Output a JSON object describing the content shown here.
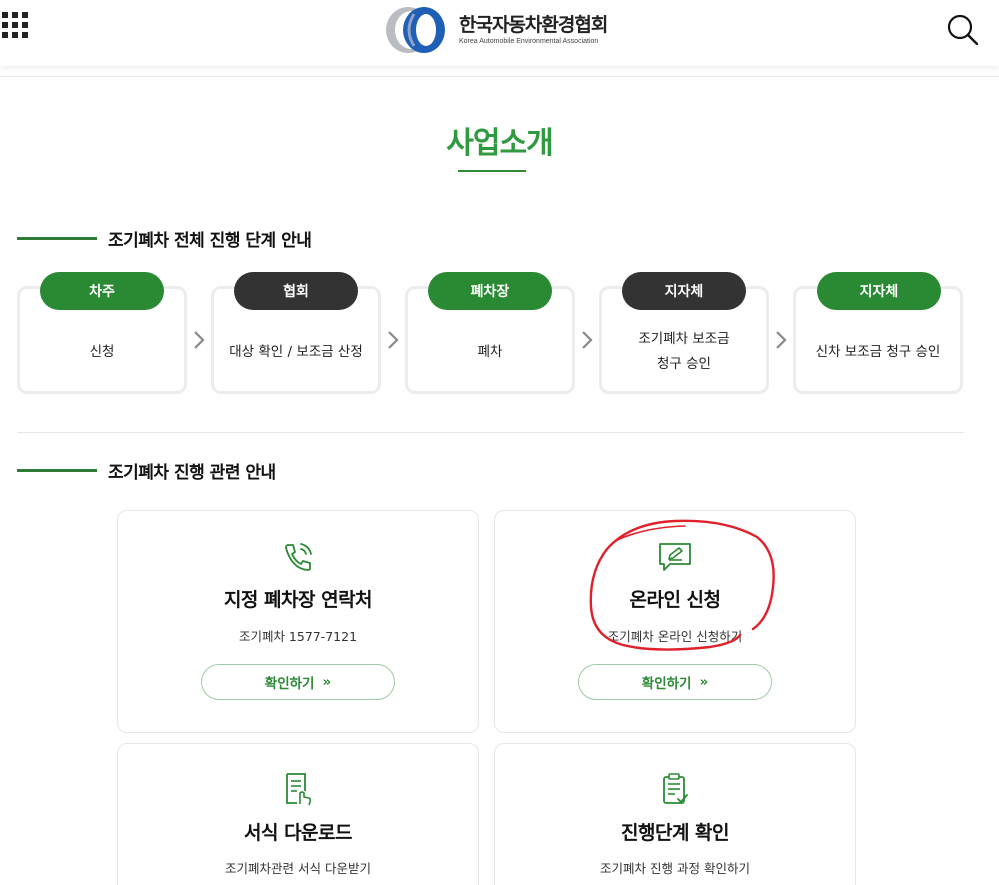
{
  "header": {
    "logo_ko": "한국자동차환경협회",
    "logo_en": "Korea Automobile Environmental Association",
    "menu_icon": "grid-menu-icon",
    "search_icon": "search-icon"
  },
  "page_title": "사업소개",
  "section1": {
    "heading": "조기폐차 전체 진행 단계 안내",
    "steps": [
      {
        "badge": "차주",
        "desc": "신청",
        "badge_color": "#2a8a34"
      },
      {
        "badge": "협회",
        "desc": "대상 확인 / 보조금 산정",
        "badge_color": "#333333"
      },
      {
        "badge": "폐차장",
        "desc": "폐차",
        "badge_color": "#2a8a34"
      },
      {
        "badge": "지자체",
        "desc": "조기폐차 보조금\n청구 승인",
        "badge_color": "#333333"
      },
      {
        "badge": "지자체",
        "desc": "신차 보조금 청구 승인",
        "badge_color": "#2a8a34"
      }
    ]
  },
  "section2": {
    "heading": "조기폐차 진행 관련 안내",
    "cards": [
      {
        "icon": "phone-icon",
        "title": "지정 폐차장 연락처",
        "sub": "조기폐차 1577-7121",
        "button": "확인하기"
      },
      {
        "icon": "chat-edit-icon",
        "title": "온라인 신청",
        "sub": "조기폐차 온라인 신청하기",
        "button": "확인하기"
      },
      {
        "icon": "document-download-icon",
        "title": "서식 다운로드",
        "sub": "조기폐차관련 서식 다운받기"
      },
      {
        "icon": "clipboard-check-icon",
        "title": "진행단계 확인",
        "sub": "조기폐차 진행 과정 확인하기"
      }
    ]
  },
  "colors": {
    "accent": "#2a8a34",
    "dark": "#333333",
    "annotation": "#e0202a"
  }
}
